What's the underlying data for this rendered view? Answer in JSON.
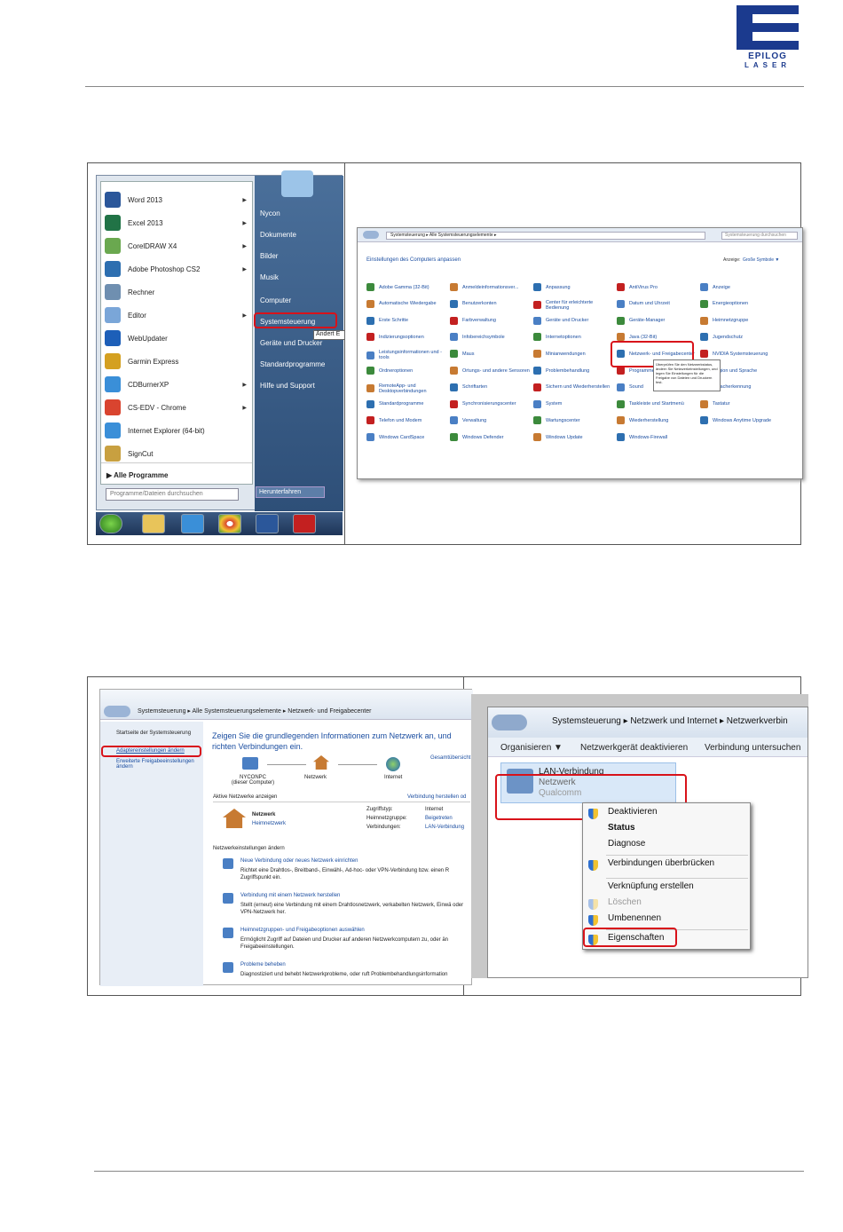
{
  "logo": {
    "top": "EPILOG",
    "bottom": "LASER"
  },
  "start_menu": {
    "programs": [
      {
        "label": "Word 2013",
        "color": "#2b579a",
        "arrow": true
      },
      {
        "label": "Excel 2013",
        "color": "#217346",
        "arrow": true
      },
      {
        "label": "CorelDRAW X4",
        "color": "#6aa84f",
        "arrow": true
      },
      {
        "label": "Adobe Photoshop CS2",
        "color": "#2d6fb0",
        "arrow": true
      },
      {
        "label": "Rechner",
        "color": "#6f8fb0",
        "arrow": false
      },
      {
        "label": "Editor",
        "color": "#7aa6d8",
        "arrow": true
      },
      {
        "label": "WebUpdater",
        "color": "#1d5fb8",
        "arrow": false
      },
      {
        "label": "Garmin Express",
        "color": "#d4a020",
        "arrow": false
      },
      {
        "label": "CDBurnerXP",
        "color": "#3a8fd8",
        "arrow": true
      },
      {
        "label": "CS-EDV - Chrome",
        "color": "#d9442f",
        "arrow": true
      },
      {
        "label": "Internet Explorer (64-bit)",
        "color": "#3a8fd8",
        "arrow": false
      },
      {
        "label": "SignCut",
        "color": "#c8a040",
        "arrow": false
      }
    ],
    "all_programs": "Alle Programme",
    "search_placeholder": "Programme/Dateien durchsuchen",
    "right": [
      "Nycon",
      "Dokumente",
      "Bilder",
      "Musik",
      "Computer",
      "Systemsteuerung",
      "Geräte und Drucker",
      "Standardprogramme",
      "Hilfe und Support"
    ],
    "tooltip": "Ändert E",
    "shutdown": "Herunterfahren"
  },
  "control_panel": {
    "address": "Systemsteuerung ▸ Alle Systemsteuerungselemente ▸",
    "search": "Systemsteuerung durchsuchen",
    "heading": "Einstellungen des Computers anpassen",
    "view_label": "Anzeige:",
    "view_value": "Große Symbole ▼",
    "columns": [
      [
        "Adobe Gamma (32-Bit)",
        "Automatische Wiedergabe",
        "Erste Schritte",
        "Indizierungsoptionen",
        "Leistungsinformationen und -tools",
        "Ordneroptionen",
        "RemoteApp- und Desktopverbindungen",
        "Standardprogramme",
        "Telefon und Modem",
        "Windows CardSpace"
      ],
      [
        "Anmeldeinformationsver...",
        "Benutzerkonten",
        "Farbverwaltung",
        "Infobereichsymbole",
        "Maus",
        "Ortungs- und andere Sensoren",
        "Schriftarten",
        "Synchronisierungscenter",
        "Verwaltung",
        "Windows Defender"
      ],
      [
        "Anpassung",
        "Center für erleichterte Bedienung",
        "Geräte und Drucker",
        "Internetoptionen",
        "Minianwendungen",
        "Problembehandlung",
        "Sichern und Wiederherstellen",
        "System",
        "Wartungscenter",
        "Windows Update"
      ],
      [
        "AntiVirus Pro",
        "Datum und Uhrzeit",
        "Geräte-Manager",
        "Java (32-Bit)",
        "Netzwerk- und Freigabecenter",
        "Programme und Funktionen",
        "Sound",
        "Taskleiste und Startmenü",
        "Wiederherstellung",
        "Windows-Firewall"
      ],
      [
        "Anzeige",
        "Energieoptionen",
        "Heimnetzgruppe",
        "Jugendschutz",
        "NVIDIA Systemsteuerung",
        "Region und Sprache",
        "Spracherkennung",
        "Tastatur",
        "Windows Anytime Upgrade",
        ""
      ]
    ],
    "tooltip": "Überprüfen Sie den Netzwerkstatus, ändern Sie Netzwerkeinstellungen, und legen Sie Einstellungen für die Freigabe von Dateien und Druckern fest."
  },
  "network_center": {
    "address": "Systemsteuerung ▸ Alle Systemsteuerungselemente ▸ Netzwerk- und Freigabecenter",
    "sidebar": [
      "Startseite der Systemsteuerung",
      "Adaptereinstellungen ändern",
      "Erweiterte Freigabeeinstellungen ändern"
    ],
    "heading": "Zeigen Sie die grundlegenden Informationen zum Netzwerk an, und richten Verbindungen ein.",
    "map_link": "Gesamtübersicht",
    "map": [
      "NYCONPC\n(dieser Computer)",
      "Netzwerk",
      "Internet"
    ],
    "active_label": "Aktive Netzwerke anzeigen",
    "connect_link": "Verbindung herstellen od",
    "network_name": "Netzwerk",
    "network_type": "Heimnetzwerk",
    "props": [
      [
        "Zugriffstyp:",
        "Internet"
      ],
      [
        "Heimnetzgruppe:",
        "Beigetreten"
      ],
      [
        "Verbindungen:",
        "LAN-Verbindung"
      ]
    ],
    "change_label": "Netzwerkeinstellungen ändern",
    "tasks": [
      {
        "title": "Neue Verbindung oder neues Netzwerk einrichten",
        "desc": "Richtet eine Drahtlos-, Breitband-, Einwähl-, Ad-hoc- oder VPN-Verbindung bzw. einen R Zugriffspunkt ein."
      },
      {
        "title": "Verbindung mit einem Netzwerk herstellen",
        "desc": "Stellt (erneut) eine Verbindung mit einem Drahtlosnetzwerk, verkabelten Netzwerk, Einwä oder VPN-Netzwerk her."
      },
      {
        "title": "Heimnetzgruppen- und Freigabeoptionen auswählen",
        "desc": "Ermöglicht Zugriff auf Dateien und Drucker auf anderen Netzwerkcomputern zu, oder än Freigabeeinstellungen."
      },
      {
        "title": "Probleme beheben",
        "desc": "Diagnostiziert und behebt Netzwerkprobleme, oder ruft Problembehandlungsinformation"
      }
    ]
  },
  "adapter": {
    "address": "Systemsteuerung ▸ Netzwerk und Internet ▸ Netzwerkverbin",
    "toolbar": [
      "Organisieren ▼",
      "Netzwerkgerät deaktivieren",
      "Verbindung untersuchen"
    ],
    "connection": {
      "name": "LAN-Verbindung",
      "status": "Netzwerk",
      "device": "Qualcomm"
    },
    "menu": [
      {
        "label": "Deaktivieren",
        "shield": true,
        "bold": false
      },
      {
        "label": "Status",
        "shield": false,
        "bold": true
      },
      {
        "label": "Diagnose",
        "shield": false,
        "bold": false
      },
      {
        "label": "Verbindungen überbrücken",
        "shield": true,
        "bold": false
      },
      {
        "label": "Verknüpfung erstellen",
        "shield": false,
        "bold": false
      },
      {
        "label": "Löschen",
        "shield": true,
        "bold": false
      },
      {
        "label": "Umbenennen",
        "shield": true,
        "bold": false
      },
      {
        "label": "Eigenschaften",
        "shield": true,
        "bold": false
      }
    ]
  }
}
